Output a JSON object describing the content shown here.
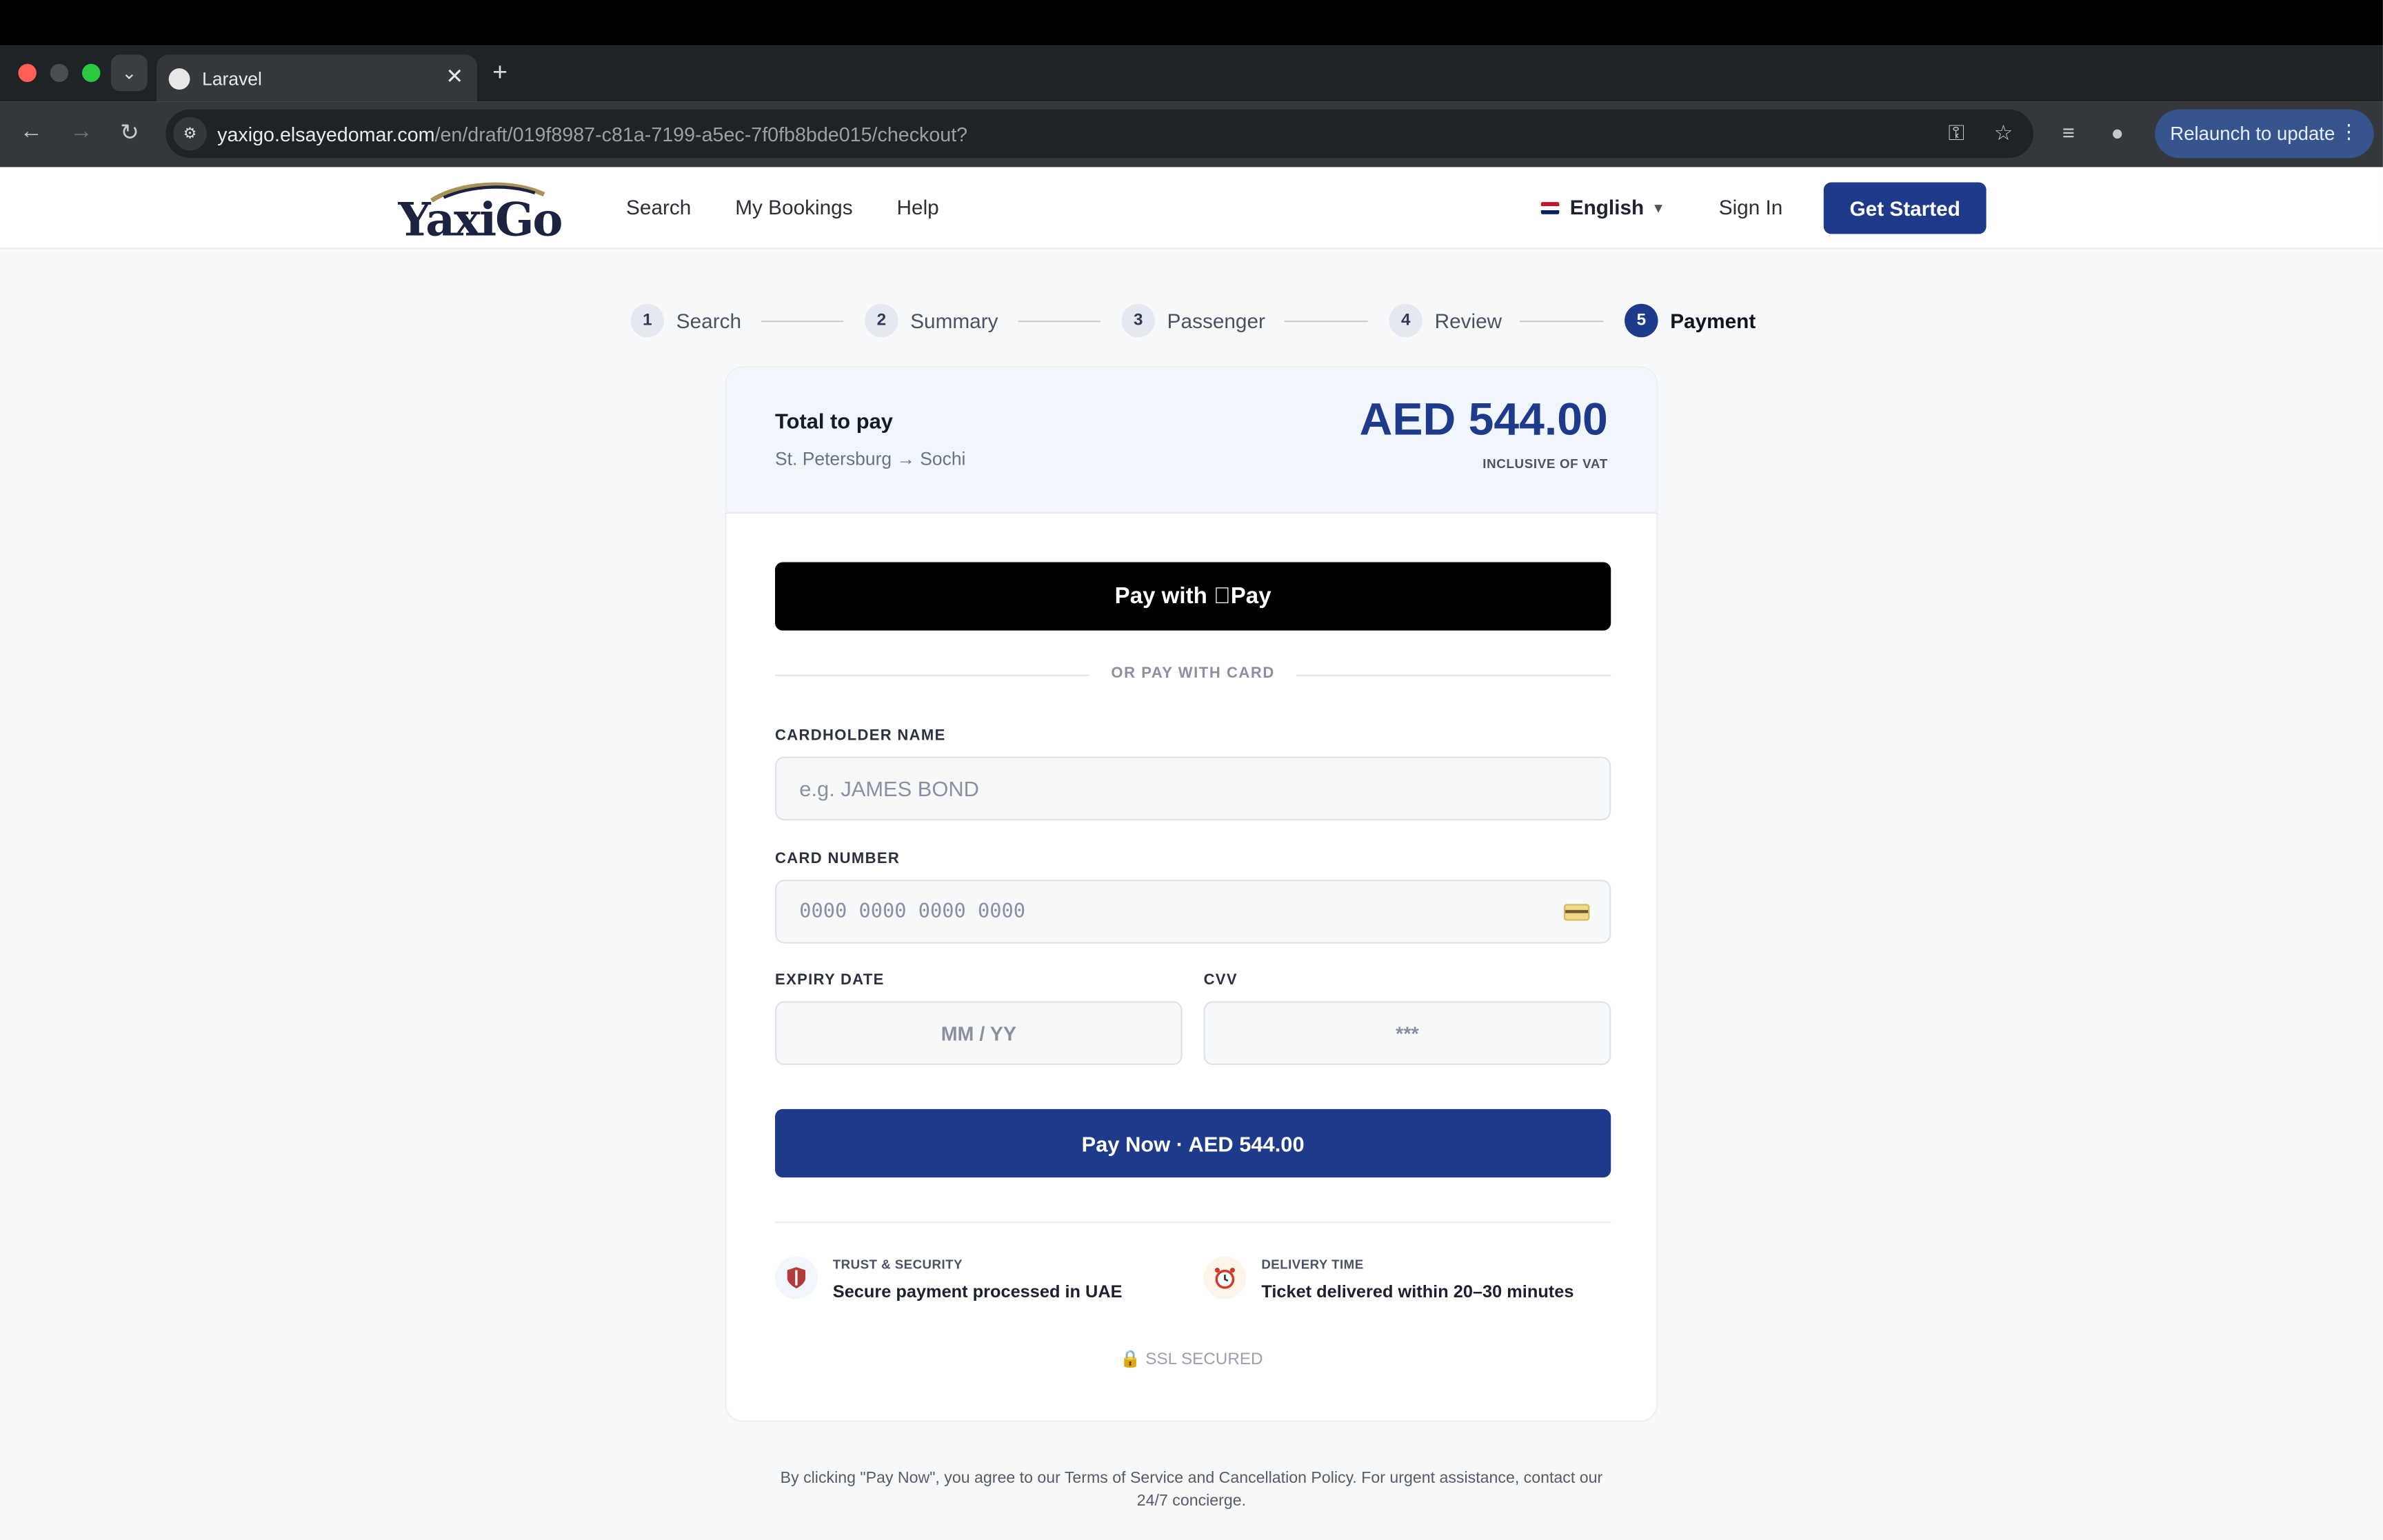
{
  "browser": {
    "tab_title": "Laravel",
    "url_host": "yaxigo.elsayedomar.com",
    "url_path": "/en/draft/019f8987-c81a-7199-a5ec-7f0fb8bde015/checkout?",
    "relaunch_label": "Relaunch to update"
  },
  "site": {
    "logo_text": "YaxiGo",
    "nav": [
      "Search",
      "My Bookings",
      "Help"
    ],
    "language": "English",
    "sign_in": "Sign In",
    "get_started": "Get Started"
  },
  "stepper": {
    "steps": [
      {
        "num": "1",
        "label": "Search"
      },
      {
        "num": "2",
        "label": "Summary"
      },
      {
        "num": "3",
        "label": "Passenger"
      },
      {
        "num": "4",
        "label": "Review"
      },
      {
        "num": "5",
        "label": "Payment"
      }
    ],
    "active": 5
  },
  "summary": {
    "total_label": "Total to pay",
    "route": "St. Petersburg → Sochi",
    "amount": "AED 544.00",
    "vat_note": "INCLUSIVE OF VAT"
  },
  "payment": {
    "apple_pay_label": "Pay with Pay",
    "divider": "OR PAY WITH CARD",
    "cardholder_label": "CARDHOLDER NAME",
    "cardholder_placeholder": "e.g. JAMES BOND",
    "card_number_label": "CARD NUMBER",
    "card_number_placeholder": "0000 0000 0000 0000",
    "expiry_label": "EXPIRY DATE",
    "expiry_placeholder": "MM / YY",
    "cvv_label": "CVV",
    "cvv_placeholder": "***",
    "pay_now": "Pay Now · AED 544.00"
  },
  "trust": {
    "security_kicker": "TRUST & SECURITY",
    "security_text": "Secure payment processed in UAE",
    "delivery_kicker": "DELIVERY TIME",
    "delivery_text": "Ticket delivered within 20–30 minutes",
    "ssl": "SSL SECURED"
  },
  "footer_note": "By clicking \"Pay Now\", you agree to our Terms of Service and Cancellation Policy. For urgent assistance, contact our 24/7 concierge.",
  "colors": {
    "brand_primary": "#1e3a8a",
    "page_bg": "#f7f8fa",
    "summary_bg": "#f1f5fd"
  }
}
